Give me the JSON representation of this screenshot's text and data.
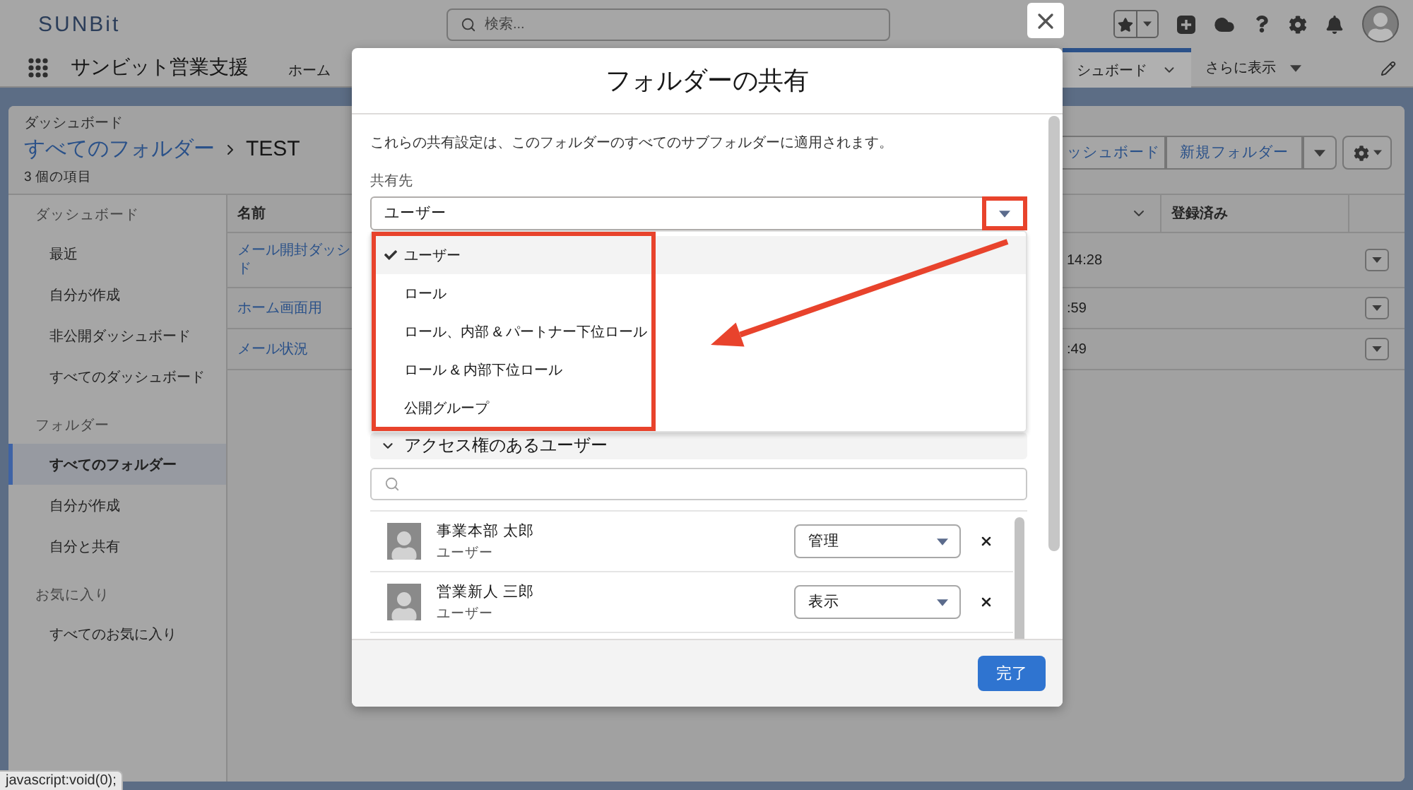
{
  "header": {
    "logo": "SUNBit",
    "search": {
      "placeholder": "検索..."
    }
  },
  "nav": {
    "app_name": "サンビット営業支援",
    "tabs": [
      {
        "label": "ホーム",
        "selected": false
      },
      {
        "label": "シュボード",
        "selected": true
      }
    ],
    "more": "さらに表示"
  },
  "page_header": {
    "object": "ダッシュボード",
    "breadcrumb": "すべてのフォルダー",
    "title": "TEST",
    "count": "3 個の項目",
    "buttons": [
      "ッシュボード",
      "新規フォルダー"
    ]
  },
  "sidebar": {
    "sections": [
      {
        "heading": "ダッシュボード",
        "items": [
          {
            "label": "最近",
            "selected": false
          },
          {
            "label": "自分が作成",
            "selected": false
          },
          {
            "label": "非公開ダッシュボード",
            "selected": false
          },
          {
            "label": "すべてのダッシュボード",
            "selected": false
          }
        ]
      },
      {
        "heading": "フォルダー",
        "items": [
          {
            "label": "すべてのフォルダー",
            "selected": true
          },
          {
            "label": "自分が作成",
            "selected": false
          },
          {
            "label": "自分と共有",
            "selected": false
          }
        ]
      },
      {
        "heading": "お気に入り",
        "items": [
          {
            "label": "すべてのお気に入り",
            "selected": false
          }
        ]
      }
    ]
  },
  "table": {
    "columns": [
      {
        "kind": "label",
        "label": "名前"
      },
      {
        "kind": "chevron"
      },
      {
        "kind": "label",
        "label": "登録済み"
      }
    ],
    "rows": [
      {
        "name_lines": [
          "メール開封ダッシ",
          "ド"
        ],
        "column_3": "14:28"
      },
      {
        "name_lines": [
          "ホーム画面用"
        ],
        "column_3": ":59"
      },
      {
        "name_lines": [
          "メール状況"
        ],
        "column_3": ":49"
      }
    ]
  },
  "dialog": {
    "title": "フォルダーの共有",
    "note": "これらの共有設定は、このフォルダーのすべてのサブフォルダーに適用されます。",
    "share_with": {
      "label": "共有先",
      "value": "ユーザー",
      "expanded": true,
      "options": [
        {
          "label": "ユーザー",
          "selected": true
        },
        {
          "label": "ロール",
          "selected": false
        },
        {
          "label": "ロール、内部 & パートナー下位ロール",
          "selected": false
        },
        {
          "label": "ロール & 内部下位ロール",
          "selected": false
        },
        {
          "label": "公開グループ",
          "selected": false
        }
      ]
    },
    "access": {
      "title": "アクセス権のあるユーザー",
      "expanded": true,
      "users": [
        {
          "name": "事業本部 太郎",
          "type": "ユーザー",
          "access": "管理"
        },
        {
          "name": "営業新人 三郎",
          "type": "ユーザー",
          "access": "表示"
        }
      ]
    },
    "done_button": "完了"
  },
  "status_bar": {
    "url": "javascript:void(0);"
  }
}
